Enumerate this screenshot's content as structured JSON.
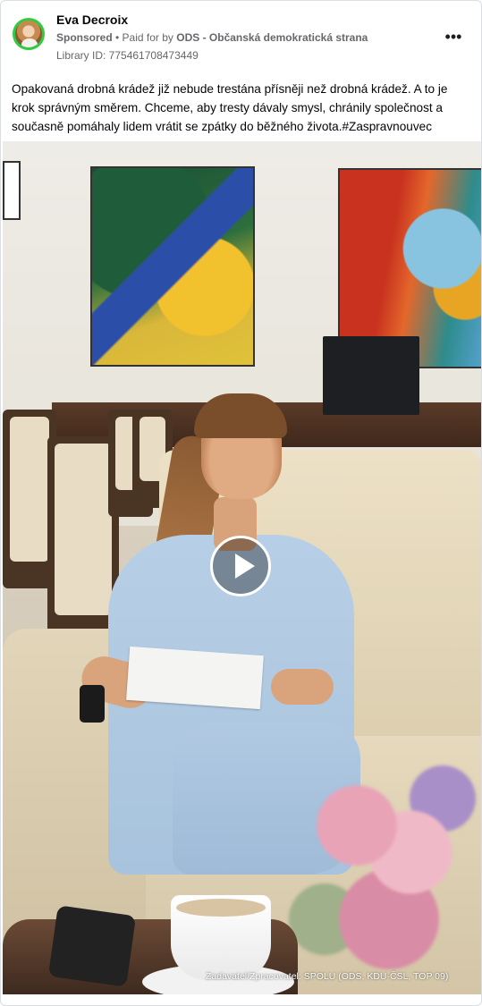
{
  "post": {
    "author": "Eva Decroix",
    "sponsored_label": "Sponsored",
    "paid_prefix": " • Paid for by ",
    "payer": "ODS - Občanská demokratická strana",
    "library_id": "Library ID: 775461708473449",
    "more_label": "•••",
    "caption": "Opakovaná drobná krádež již nebude trestána přísněji než drobná krádež. A to je krok správným směrem. Chceme, aby tresty dávaly smysl, chránily společnost a současně pomáhaly lidem vrátit se zpátky do běžného života.#Zaspravnouvec"
  },
  "video": {
    "credit_text": "Zadavatel/Zpracovatel: SPOLU (ODS, KDU-ČSL, TOP 09)",
    "play_icon": "play-icon"
  },
  "colors": {
    "avatar_ring": "#2ecc40",
    "meta_text": "#65676b"
  }
}
